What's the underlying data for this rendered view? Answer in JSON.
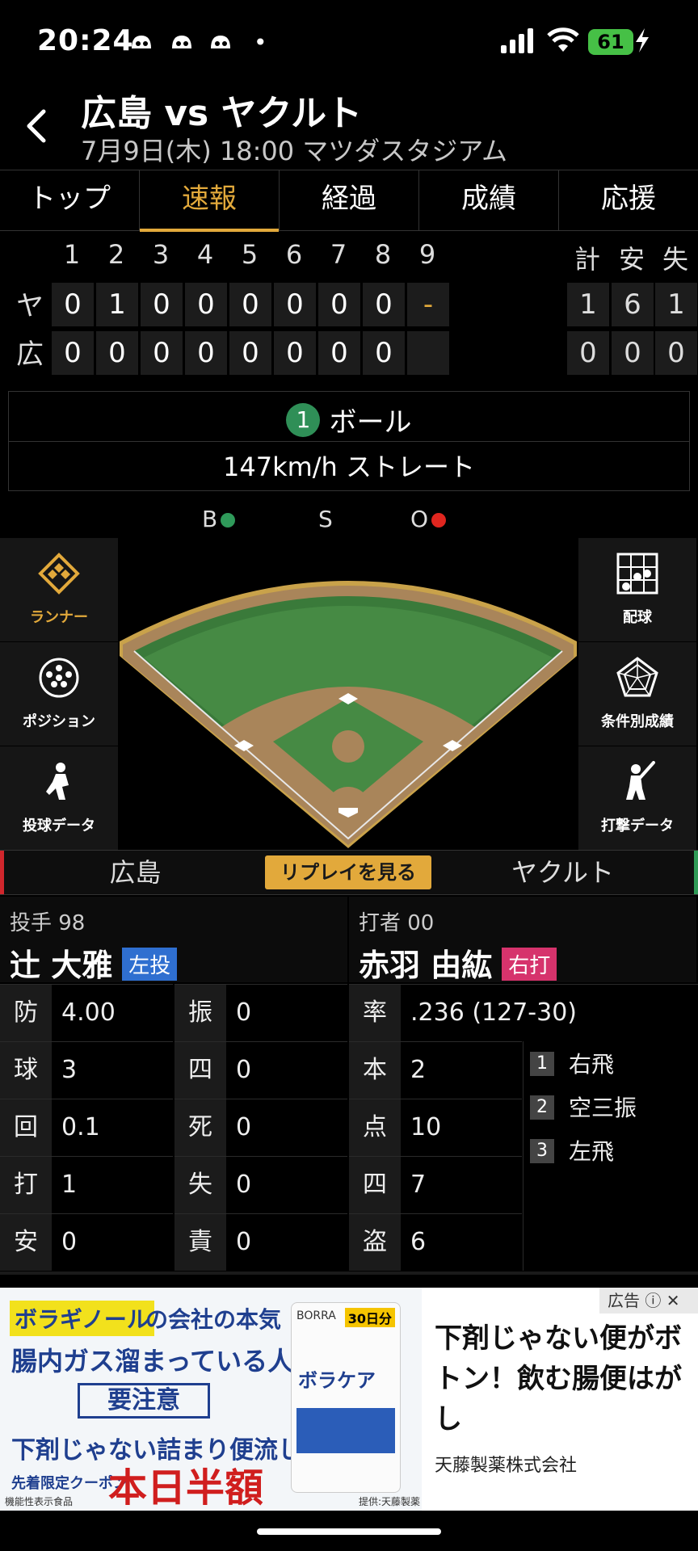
{
  "status": {
    "time": "20:24",
    "battery": "61",
    "notif_dot": "•"
  },
  "header": {
    "title": "広島 vs ヤクルト",
    "subtitle": "7月9日(木) 18:00 マツダスタジアム"
  },
  "tabs": [
    {
      "label": "トップ",
      "active": false
    },
    {
      "label": "速報",
      "active": true
    },
    {
      "label": "経過",
      "active": false
    },
    {
      "label": "成績",
      "active": false
    },
    {
      "label": "応援",
      "active": false
    }
  ],
  "scoreboard": {
    "innings": [
      "1",
      "2",
      "3",
      "4",
      "5",
      "6",
      "7",
      "8",
      "9"
    ],
    "totals_headers": [
      "計",
      "安",
      "失"
    ],
    "teams": [
      {
        "abbr": "ヤ",
        "scores": [
          "0",
          "1",
          "0",
          "0",
          "0",
          "0",
          "0",
          "0",
          "-"
        ],
        "totals": [
          "1",
          "6",
          "1"
        ]
      },
      {
        "abbr": "広",
        "scores": [
          "0",
          "0",
          "0",
          "0",
          "0",
          "0",
          "0",
          "0",
          ""
        ],
        "totals": [
          "0",
          "0",
          "0"
        ]
      }
    ]
  },
  "pitch": {
    "number": "1",
    "result": "ボール",
    "detail": "147km/h ストレート"
  },
  "count": {
    "b": "B",
    "s": "S",
    "o": "O",
    "ball_color": "#2f9a5a",
    "out_color": "#e0261f"
  },
  "side_left": [
    {
      "label": "ランナー",
      "icon": "runner-diamond-icon",
      "active": true
    },
    {
      "label": "ポジション",
      "icon": "position-icon",
      "active": false
    },
    {
      "label": "投球データ",
      "icon": "pitcher-icon",
      "active": false
    }
  ],
  "side_right": [
    {
      "label": "配球",
      "icon": "pitch-grid-icon"
    },
    {
      "label": "条件別成績",
      "icon": "radar-chart-icon"
    },
    {
      "label": "打撃データ",
      "icon": "batter-icon"
    }
  ],
  "teambar": {
    "home": "広島",
    "replay": "リプレイを見る",
    "away": "ヤクルト",
    "home_color": "#d0262c",
    "away_color": "#2e9a56"
  },
  "pitcher": {
    "role": "投手 98",
    "name": "辻 大雅",
    "hand": "左投",
    "hand_color": "#2f6fd0",
    "stats_left": [
      [
        "防",
        "4.00"
      ],
      [
        "球",
        "3"
      ],
      [
        "回",
        "0.1"
      ],
      [
        "打",
        "1"
      ],
      [
        "安",
        "0"
      ]
    ],
    "stats_right": [
      [
        "振",
        "0"
      ],
      [
        "四",
        "0"
      ],
      [
        "死",
        "0"
      ],
      [
        "失",
        "0"
      ],
      [
        "責",
        "0"
      ]
    ]
  },
  "batter": {
    "role": "打者 00",
    "name": "赤羽 由紘",
    "hand": "右打",
    "hand_color": "#d6336c",
    "avg": [
      "率",
      ".236 (127-30)"
    ],
    "stats": [
      [
        "本",
        "2"
      ],
      [
        "点",
        "10"
      ],
      [
        "四",
        "7"
      ],
      [
        "盗",
        "6"
      ]
    ],
    "at_bats": [
      [
        "1",
        "右飛"
      ],
      [
        "2",
        "空三振"
      ],
      [
        "3",
        "左飛"
      ]
    ]
  },
  "ad": {
    "label": "広告",
    "brand": "ボラギノール",
    "line1": "の会社の本気",
    "line2": "腸内ガス溜まっている人、",
    "line3": "要注意",
    "line4": "下剤じゃない詰まり便流し",
    "coupon": "先着限定クーポン",
    "big": "本日半額",
    "footnote_left": "機能性表示食品",
    "footnote_right": "提供:天藤製薬",
    "pack_brand": "BORRA",
    "pack_days": "30日分",
    "pack_name": "ボラケア",
    "headline": "下剤じゃない便がボトン！飲む腸便はがし",
    "company": "天藤製薬株式会社"
  }
}
